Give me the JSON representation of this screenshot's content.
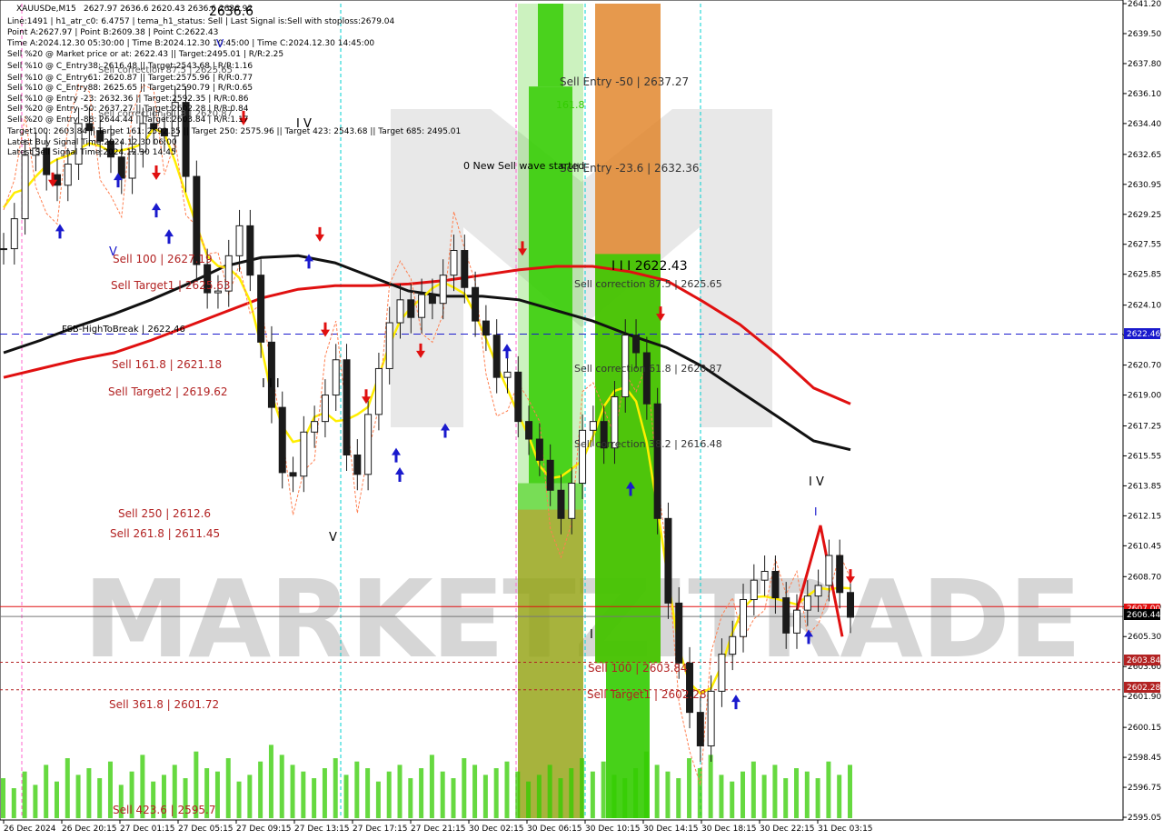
{
  "symbol_line": "XAUUSDe,M15",
  "title_overlap": "2627.97 2636.6 2620.43 2636.6 2636.92",
  "info_lines": [
    "Line:1491 | h1_atr_c0: 6.4757 | tema_h1_status: Sell | Last Signal is:Sell with stoploss:2679.04",
    "Point A:2627.97 | Point B:2609.38 | Point C:2622.43",
    "Time A:2024.12.30 05:30:00 | Time B:2024.12.30 10:45:00 | Time C:2024.12.30 14:45:00",
    "Sell %20 @ Market price or at: 2622.43 || Target:2495.01 | R/R:2.25",
    "Sell %10 @ C_Entry38: 2616.48 || Target:2543.68 | R/R:1.16",
    "Sell %10 @ C_Entry61: 2620.87 || Target:2575.96 | R/R:0.77",
    "Sell %10 @ C_Entry88: 2625.65 || Target:2590.79 | R/R:0.65",
    "Sell %10 @ Entry -23: 2632.36 || Target:2592.35 | R/R:0.86",
    "Sell %20 @ Entry -50: 2637.27 || Target:2602.28 | R/R:0.84",
    "Sell %20 @ Entry -88: 2644.44 || Target:2603.84 | R/R:1.17",
    "Target100: 2603.84 || Target 161: 2592.35 || Target 250: 2575.96 || Target 423: 2543.68 || Target 685: 2495.01",
    "Latest Buy Signal Time:2024.12.30 06:00",
    "Latest Sell Signal Time:2024.12.30 14:45"
  ],
  "overlap_texts": [
    "Sell correction 87.5 | 2625.65",
    "Sell correction 61.8 | 2620.87",
    "2636.6"
  ],
  "chart_labels": {
    "sell_entry_50": "Sell Entry -50 | 2637.27",
    "sell_entry_23": "Sell Entry -23.6 | 2632.36",
    "sell_161_green": "161.8",
    "new_sell_wave": "0 New Sell wave started",
    "point_c": "I I I 2622.43",
    "sell_correction_875": "Sell correction 87.5 | 2625.65",
    "sell_correction_618": "Sell correction 61.8 | 2620.87",
    "sell_correction_382": "Sell correction 38.2 | 2616.48",
    "fsb": "FSB-HighToBreak | 2622.46",
    "sell_100_left": "Sell 100 | 2627.19",
    "sell_target1_left": "Sell Target1 | 2625.63",
    "sell_1618_left": "Sell 161.8 | 2621.18",
    "sell_target2_left": "Sell Target2 | 2619.62",
    "sell_250": "Sell  250 | 2612.6",
    "sell_2618": "Sell  261.8 | 2611.45",
    "sell_3618": "Sell  361.8 | 2601.72",
    "sell_4236": "Sell  423.6 | 2595.7",
    "sell_100_right": "Sell 100 | 2603.84",
    "sell_target1_right": "Sell Target1 | 2602.28",
    "wave_iv_left": "I V",
    "wave_iii_left": "I I I",
    "wave_v_top": "V",
    "wave_v_left": "V",
    "wave_v_low": "V",
    "wave_iv_right": "I V",
    "wave_i_right": "I",
    "wave_i_low": "I"
  },
  "watermark": "MARKETZITRADE",
  "price_badges": {
    "fsb": "2622.46",
    "red_line": "2607.00",
    "current": "2606.44",
    "sell100": "2603.84",
    "target1": "2602.28"
  },
  "colors": {
    "background": "#ffffff",
    "bullish": "#1a1a1a",
    "bearish": "#1a1a1a",
    "ma_red": "#e01010",
    "ma_black": "#111111",
    "tema_yellow": "#ffee00",
    "label_red": "#b22222",
    "fsb_line": "#1a1acd",
    "green_zone": "#33cc00",
    "orange_zone": "#e08020",
    "volume": "#33cc00",
    "cyan_line": "#00d0d0",
    "magenta_line": "#ff66cc"
  },
  "chart_data": {
    "type": "candlestick",
    "symbol": "XAUUSDe",
    "timeframe": "M15",
    "ylim": [
      2595.0,
      2641.2
    ],
    "y_ticks": [
      "2641.20",
      "2639.50",
      "2637.80",
      "2636.10",
      "2634.40",
      "2632.65",
      "2630.95",
      "2629.25",
      "2627.55",
      "2625.85",
      "2624.10",
      "2622.40",
      "2620.70",
      "2619.00",
      "2617.25",
      "2615.55",
      "2613.85",
      "2612.15",
      "2610.45",
      "2608.70",
      "2607.00",
      "2605.30",
      "2603.60",
      "2601.90",
      "2600.15",
      "2598.45",
      "2596.75",
      "2595.05"
    ],
    "x_ticks": [
      "26 Dec 2024",
      "26 Dec 20:15",
      "27 Dec 01:15",
      "27 Dec 05:15",
      "27 Dec 09:15",
      "27 Dec 13:15",
      "27 Dec 17:15",
      "27 Dec 21:15",
      "30 Dec 02:15",
      "30 Dec 06:15",
      "30 Dec 10:15",
      "30 Dec 14:15",
      "30 Dec 18:15",
      "30 Dec 22:15",
      "31 Dec 03:15"
    ],
    "close_path": [
      [
        0,
        2627.3
      ],
      [
        1,
        2629.0
      ],
      [
        2,
        2632.6
      ],
      [
        3,
        2633.0
      ],
      [
        4,
        2631.5
      ],
      [
        5,
        2630.9
      ],
      [
        6,
        2632.1
      ],
      [
        7,
        2634.4
      ],
      [
        8,
        2634.0
      ],
      [
        9,
        2633.4
      ],
      [
        10,
        2632.5
      ],
      [
        11,
        2631.3
      ],
      [
        12,
        2632.8
      ],
      [
        13,
        2634.4
      ],
      [
        14,
        2634.1
      ],
      [
        15,
        2633.7
      ],
      [
        16,
        2635.6
      ],
      [
        17,
        2631.4
      ],
      [
        18,
        2626.4
      ],
      [
        19,
        2624.8
      ],
      [
        20,
        2624.9
      ],
      [
        21,
        2626.9
      ],
      [
        22,
        2628.6
      ],
      [
        23,
        2625.8
      ],
      [
        24,
        2622.0
      ],
      [
        25,
        2618.3
      ],
      [
        26,
        2614.6
      ],
      [
        27,
        2614.4
      ],
      [
        28,
        2616.9
      ],
      [
        29,
        2617.5
      ],
      [
        30,
        2619.0
      ],
      [
        31,
        2621.0
      ],
      [
        32,
        2615.6
      ],
      [
        33,
        2614.5
      ],
      [
        34,
        2617.9
      ],
      [
        35,
        2620.5
      ],
      [
        36,
        2623.1
      ],
      [
        37,
        2624.4
      ],
      [
        38,
        2623.4
      ],
      [
        39,
        2624.7
      ],
      [
        40,
        2624.2
      ],
      [
        41,
        2625.8
      ],
      [
        42,
        2627.2
      ],
      [
        43,
        2625.1
      ],
      [
        44,
        2623.2
      ],
      [
        45,
        2622.4
      ],
      [
        46,
        2620.0
      ],
      [
        47,
        2620.3
      ],
      [
        48,
        2617.5
      ],
      [
        49,
        2616.5
      ],
      [
        50,
        2615.3
      ],
      [
        51,
        2613.6
      ],
      [
        52,
        2612.0
      ],
      [
        53,
        2614.0
      ],
      [
        54,
        2617.0
      ],
      [
        55,
        2617.5
      ],
      [
        56,
        2616.0
      ],
      [
        57,
        2618.9
      ],
      [
        58,
        2622.4
      ],
      [
        59,
        2621.4
      ],
      [
        60,
        2618.5
      ],
      [
        61,
        2612.0
      ],
      [
        62,
        2607.2
      ],
      [
        63,
        2603.8
      ],
      [
        64,
        2601.0
      ],
      [
        65,
        2599.1
      ],
      [
        66,
        2602.2
      ],
      [
        67,
        2604.3
      ],
      [
        68,
        2605.3
      ],
      [
        69,
        2607.4
      ],
      [
        70,
        2608.5
      ],
      [
        71,
        2609.0
      ],
      [
        72,
        2607.5
      ],
      [
        73,
        2605.5
      ],
      [
        74,
        2606.8
      ],
      [
        75,
        2607.6
      ],
      [
        76,
        2608.2
      ],
      [
        77,
        2609.9
      ],
      [
        78,
        2607.8
      ],
      [
        79,
        2606.4
      ]
    ],
    "moving_averages": [
      {
        "name": "red_ma",
        "values": [
          2620.0,
          2620.5,
          2621.0,
          2621.4,
          2622.1,
          2622.9,
          2623.7,
          2624.5,
          2625.0,
          2625.2,
          2625.2,
          2625.3,
          2625.5,
          2625.8,
          2626.1,
          2626.3,
          2626.3,
          2626.0,
          2625.5,
          2624.3,
          2623.0,
          2621.3,
          2619.4,
          2618.5
        ]
      },
      {
        "name": "black_ma",
        "values": [
          2621.4,
          2622.1,
          2622.9,
          2623.6,
          2624.4,
          2625.3,
          2626.3,
          2626.8,
          2626.9,
          2626.5,
          2625.7,
          2624.9,
          2624.6,
          2624.6,
          2624.4,
          2623.8,
          2623.2,
          2622.4,
          2621.7,
          2620.6,
          2619.2,
          2617.8,
          2616.4,
          2615.9
        ]
      }
    ],
    "volume": [
      12,
      9,
      14,
      10,
      16,
      11,
      18,
      13,
      15,
      12,
      17,
      10,
      14,
      19,
      11,
      13,
      16,
      12,
      20,
      15,
      14,
      18,
      11,
      13,
      17,
      22,
      19,
      16,
      14,
      12,
      15,
      18,
      13,
      17,
      15,
      11,
      14,
      16,
      12,
      15,
      19,
      14,
      12,
      18,
      16,
      13,
      15,
      17,
      14,
      11,
      13,
      16,
      12,
      15,
      18,
      14,
      17,
      13,
      12,
      15,
      20,
      16,
      14,
      12,
      18,
      15,
      19,
      13,
      11,
      14,
      17,
      13,
      16,
      12,
      15,
      14,
      12,
      17,
      13,
      16
    ]
  }
}
